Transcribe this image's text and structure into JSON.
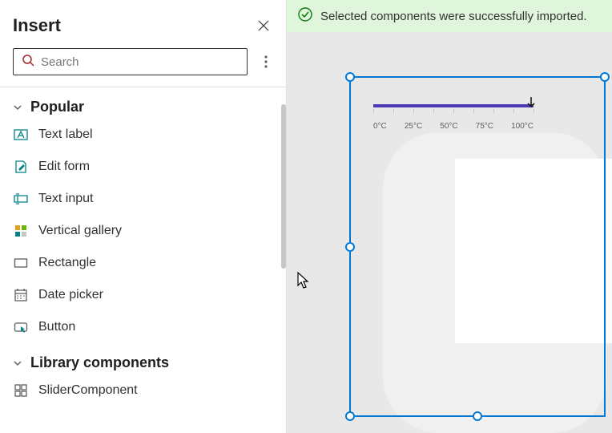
{
  "panel": {
    "title": "Insert",
    "search_placeholder": "Search"
  },
  "sections": [
    {
      "title": "Popular",
      "items": [
        {
          "label": "Text label",
          "icon": "text-label-icon"
        },
        {
          "label": "Edit form",
          "icon": "edit-form-icon"
        },
        {
          "label": "Text input",
          "icon": "text-input-icon"
        },
        {
          "label": "Vertical gallery",
          "icon": "gallery-icon"
        },
        {
          "label": "Rectangle",
          "icon": "rectangle-icon"
        },
        {
          "label": "Date picker",
          "icon": "date-picker-icon"
        },
        {
          "label": "Button",
          "icon": "button-icon"
        }
      ]
    },
    {
      "title": "Library components",
      "items": [
        {
          "label": "SliderComponent",
          "icon": "component-icon"
        }
      ]
    }
  ],
  "toast": {
    "message": "Selected components were successfully imported."
  },
  "slider": {
    "labels": [
      "0°C",
      "25°C",
      "50°C",
      "75°C",
      "100°C"
    ]
  },
  "colors": {
    "primary": "#0078d4",
    "slider_bar": "#4b39b5",
    "success_bg": "#dff6dd",
    "success_icon": "#107c10"
  }
}
